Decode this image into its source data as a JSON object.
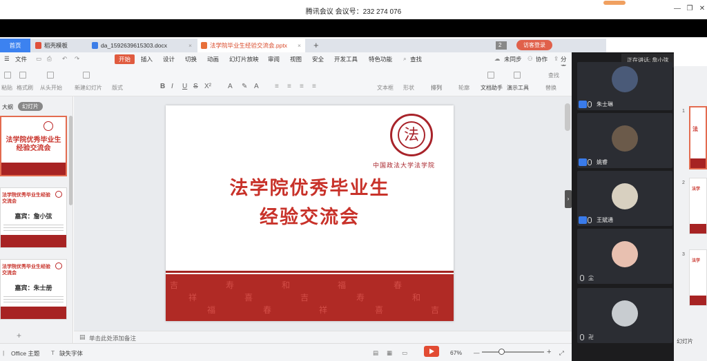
{
  "meeting": {
    "title": "腾讯会议 会议号：232 274 076",
    "speaking": "正在讲话: 詹小弦"
  },
  "tabs": [
    {
      "label": "首页"
    },
    {
      "label": "稻壳模板"
    },
    {
      "label": "da_1592639615303.docx"
    },
    {
      "label": "法学院毕业生经验交流会.pptx"
    }
  ],
  "tab_badge": "2",
  "login_label": "访客登录",
  "menu": {
    "file": "文件",
    "items": [
      "开始",
      "插入",
      "设计",
      "切换",
      "动画",
      "幻灯片放映",
      "审阅",
      "视图",
      "安全",
      "开发工具",
      "特色功能"
    ],
    "search": "查找",
    "unsync": "未同步",
    "collab": "协作",
    "share": "分享"
  },
  "ribbon": {
    "paste": "粘贴",
    "format_painter": "格式刷",
    "from_start": "从头开始",
    "new_slide": "新建幻灯片",
    "layout": "版式",
    "text_box": "文本框",
    "shape": "形状",
    "arrange": "排列",
    "outline": "轮廓",
    "doc_helper": "文档助手",
    "presenter_tools": "演示工具",
    "replace": "替换",
    "find": "查找"
  },
  "left_pane": {
    "outline_tab": "大纲",
    "slides_tab": "幻灯片",
    "thumbs": [
      {
        "title": "法学院优秀毕业生经验交流会"
      },
      {
        "title": "法学院优秀毕业生经验交流会",
        "guest": "嘉宾：詹小弦"
      },
      {
        "title": "法学院优秀毕业生经验交流会",
        "guest": "嘉宾：朱士册"
      }
    ]
  },
  "slide": {
    "university": "中国政法大学法学院",
    "seal_char": "法",
    "title_line1": "法学院优秀毕业生",
    "title_line2": "经验交流会",
    "band_glyphs": [
      "吉",
      "祥",
      "福",
      "寿",
      "喜",
      "春",
      "和",
      "吉",
      "祥",
      "福",
      "寿",
      "喜",
      "春",
      "和",
      "吉"
    ]
  },
  "notes_placeholder": "单击此处添加备注",
  "status": {
    "theme": "Office 主题",
    "missing_font": "缺失字体",
    "zoom": "67%"
  },
  "participants": [
    {
      "name": "朱士琳",
      "avatar_color": "#4a5a78"
    },
    {
      "name": "姚睿",
      "avatar_color": "#6b5a4a"
    },
    {
      "name": "王斌通",
      "avatar_color": "#d8d0c0"
    },
    {
      "name": "尘",
      "avatar_color": "#e8c0b0"
    },
    {
      "name": "卍",
      "avatar_color": "#c8ccd0"
    }
  ],
  "far_right": {
    "nums": [
      "1",
      "2",
      "3"
    ],
    "thumb_texts": [
      "法",
      "法学",
      "法学"
    ],
    "status": "幻灯片"
  },
  "colors": {
    "accent_red": "#c8322a",
    "wps_blue": "#3c82f0",
    "meeting_dark": "#1c1c1e"
  }
}
